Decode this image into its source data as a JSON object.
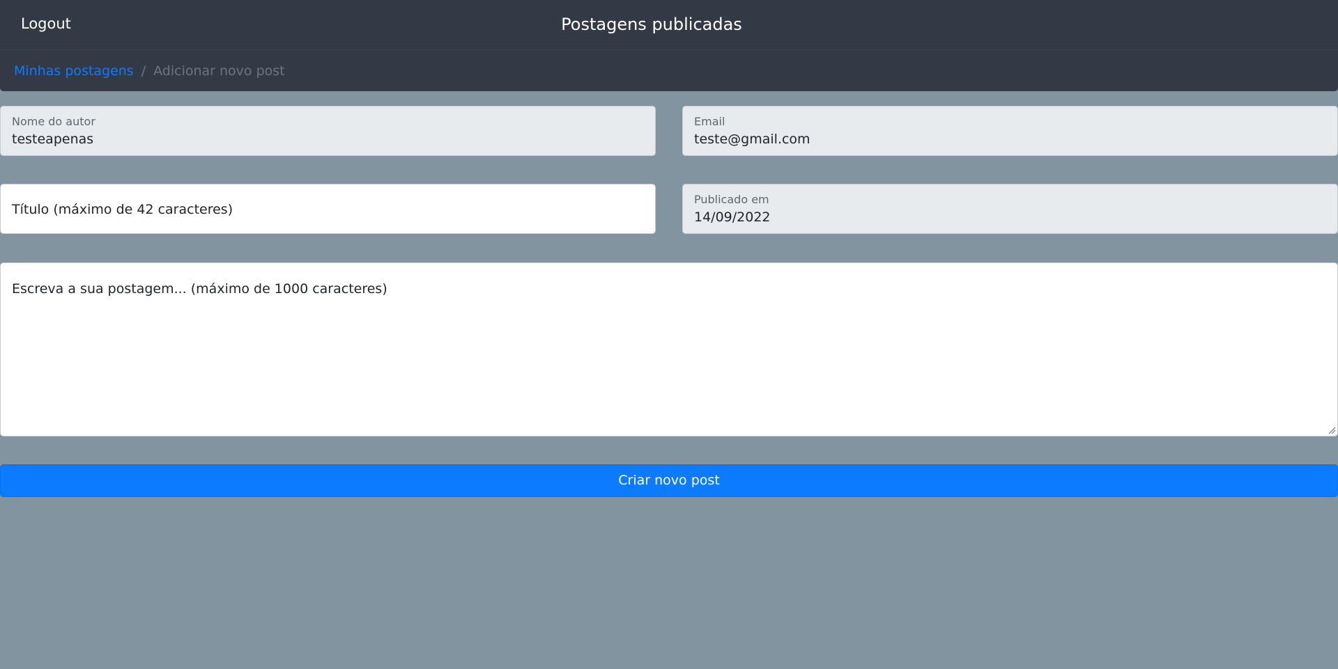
{
  "navbar": {
    "logout_label": "Logout",
    "title": "Postagens publicadas"
  },
  "breadcrumb": {
    "link_label": "Minhas postagens",
    "separator": "/",
    "current_label": "Adicionar novo post"
  },
  "form": {
    "author": {
      "label": "Nome do autor",
      "value": "testeapenas"
    },
    "email": {
      "label": "Email",
      "value": "teste@gmail.com"
    },
    "title": {
      "placeholder": "Título (máximo de 42 caracteres)",
      "value": ""
    },
    "published": {
      "label": "Publicado em",
      "value": "14/09/2022"
    },
    "body": {
      "placeholder": "Escreva a sua postagem... (máximo de 1000 caracteres)",
      "value": ""
    },
    "submit_label": "Criar novo post"
  },
  "colors": {
    "background": "#8294a0",
    "navbar": "#343a45",
    "link": "#0d7bff",
    "primary_button": "#0d7bff",
    "readonly_field": "#e8ebee"
  },
  "icons": {
    "resize": "resize-grip-icon"
  }
}
